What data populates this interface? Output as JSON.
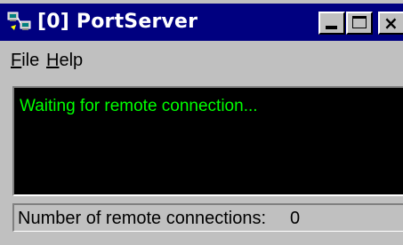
{
  "window": {
    "title": "[0] PortServer",
    "app_icon": "network-computers-icon",
    "controls": {
      "minimize_icon": "minimize-icon",
      "maximize_icon": "maximize-icon",
      "close_icon": "close-icon",
      "close_glyph": "×"
    }
  },
  "menu": {
    "file_underlined": "F",
    "file_rest": "ile",
    "help_underlined": "H",
    "help_rest": "elp"
  },
  "console": {
    "message": "Waiting for remote connection...",
    "text_color": "#00ff00",
    "background_color": "#000000"
  },
  "status": {
    "label": "Number of remote connections:",
    "count": "0"
  },
  "colors": {
    "titlebar": "#000080",
    "face": "#c0c0c0"
  }
}
